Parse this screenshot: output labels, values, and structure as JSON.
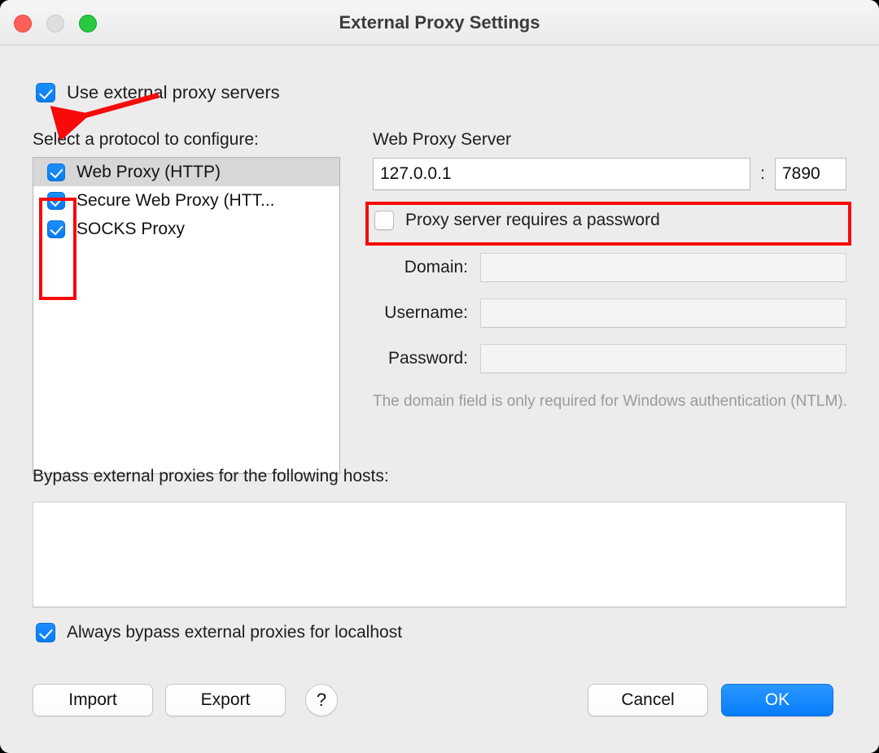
{
  "window": {
    "title": "External Proxy Settings",
    "traffic_lights": [
      {
        "name": "close",
        "color": "#ff5f57"
      },
      {
        "name": "minimize",
        "color": "#dedede"
      },
      {
        "name": "maximize",
        "color": "#28c840"
      }
    ]
  },
  "use_external_proxy": {
    "label": "Use external proxy servers",
    "checked": true
  },
  "protocol": {
    "heading": "Select a protocol to configure:",
    "items": [
      {
        "label": "Web Proxy (HTTP)",
        "checked": true,
        "selected": true
      },
      {
        "label": "Secure Web Proxy (HTT...",
        "checked": true,
        "selected": false
      },
      {
        "label": "SOCKS Proxy",
        "checked": true,
        "selected": false
      }
    ]
  },
  "web_proxy_server": {
    "heading": "Web Proxy Server",
    "host": "127.0.0.1",
    "host_placeholder": "",
    "separator": ":",
    "port": "7890",
    "port_placeholder": ""
  },
  "credentials": {
    "requires_password_label": "Proxy server requires a password",
    "requires_password_checked": false,
    "fields": [
      {
        "label": "Domain:",
        "value": "",
        "placeholder": "",
        "enabled": false
      },
      {
        "label": "Username:",
        "value": "",
        "placeholder": "",
        "enabled": false
      },
      {
        "label": "Password:",
        "value": "",
        "placeholder": "",
        "enabled": false
      }
    ],
    "note": "The domain field is only required for Windows authentication (NTLM)."
  },
  "bypass": {
    "heading": "Bypass external proxies for the following hosts:",
    "value": "",
    "placeholder": "",
    "localhost_label": "Always bypass external proxies for localhost",
    "localhost_checked": true
  },
  "buttons": {
    "import": "Import",
    "export": "Export",
    "help": "?",
    "cancel": "Cancel",
    "ok": "OK"
  },
  "annotations": {
    "color": "#f60a0a",
    "arrow_target": "use-external-proxy-checkbox",
    "boxes": [
      "protocol-checkbox-column",
      "web-proxy-server-row"
    ]
  }
}
